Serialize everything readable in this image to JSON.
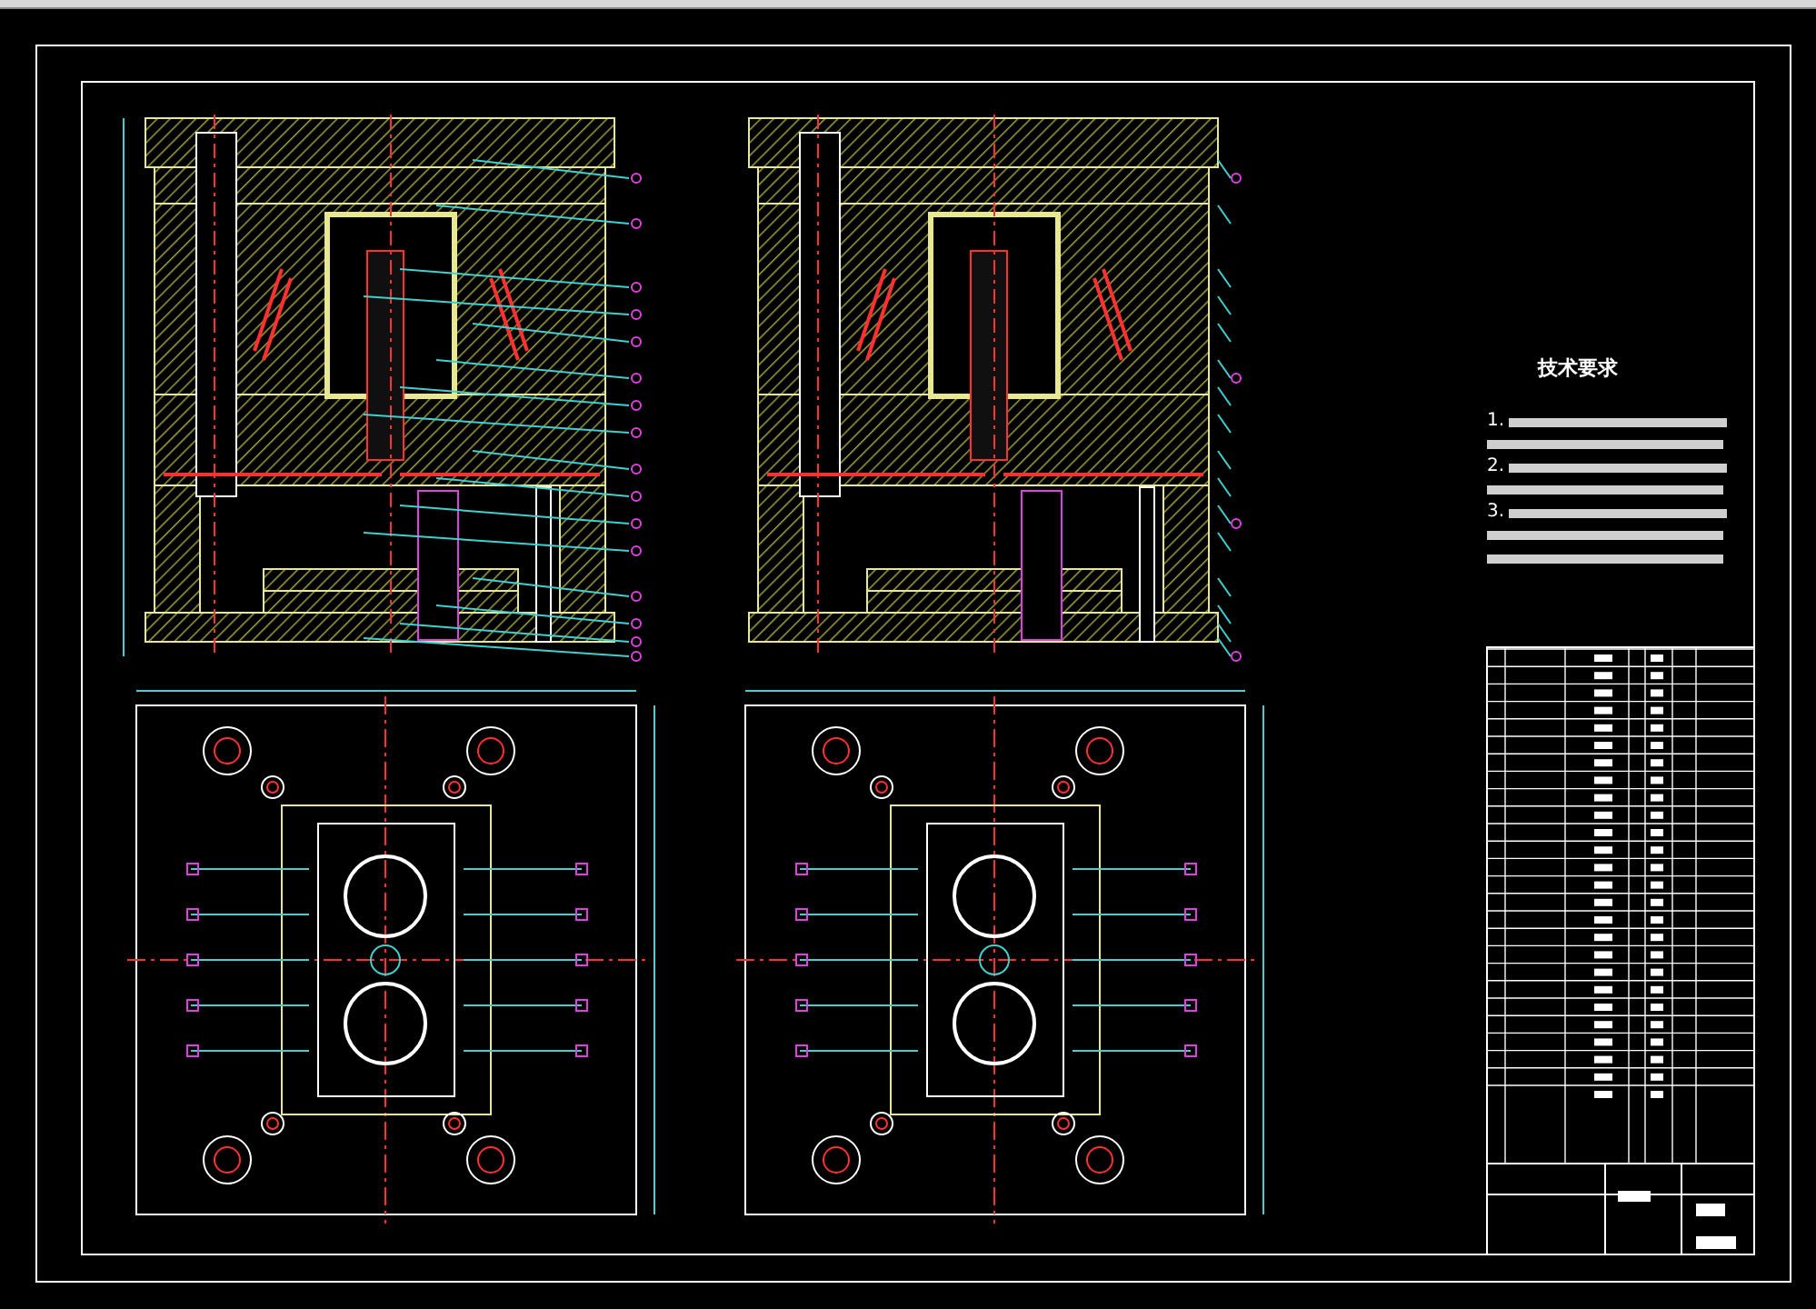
{
  "technical_requirements": {
    "title": "技术要求",
    "items": [
      {
        "number": "1."
      },
      {
        "number": "2."
      },
      {
        "number": "3."
      }
    ]
  }
}
